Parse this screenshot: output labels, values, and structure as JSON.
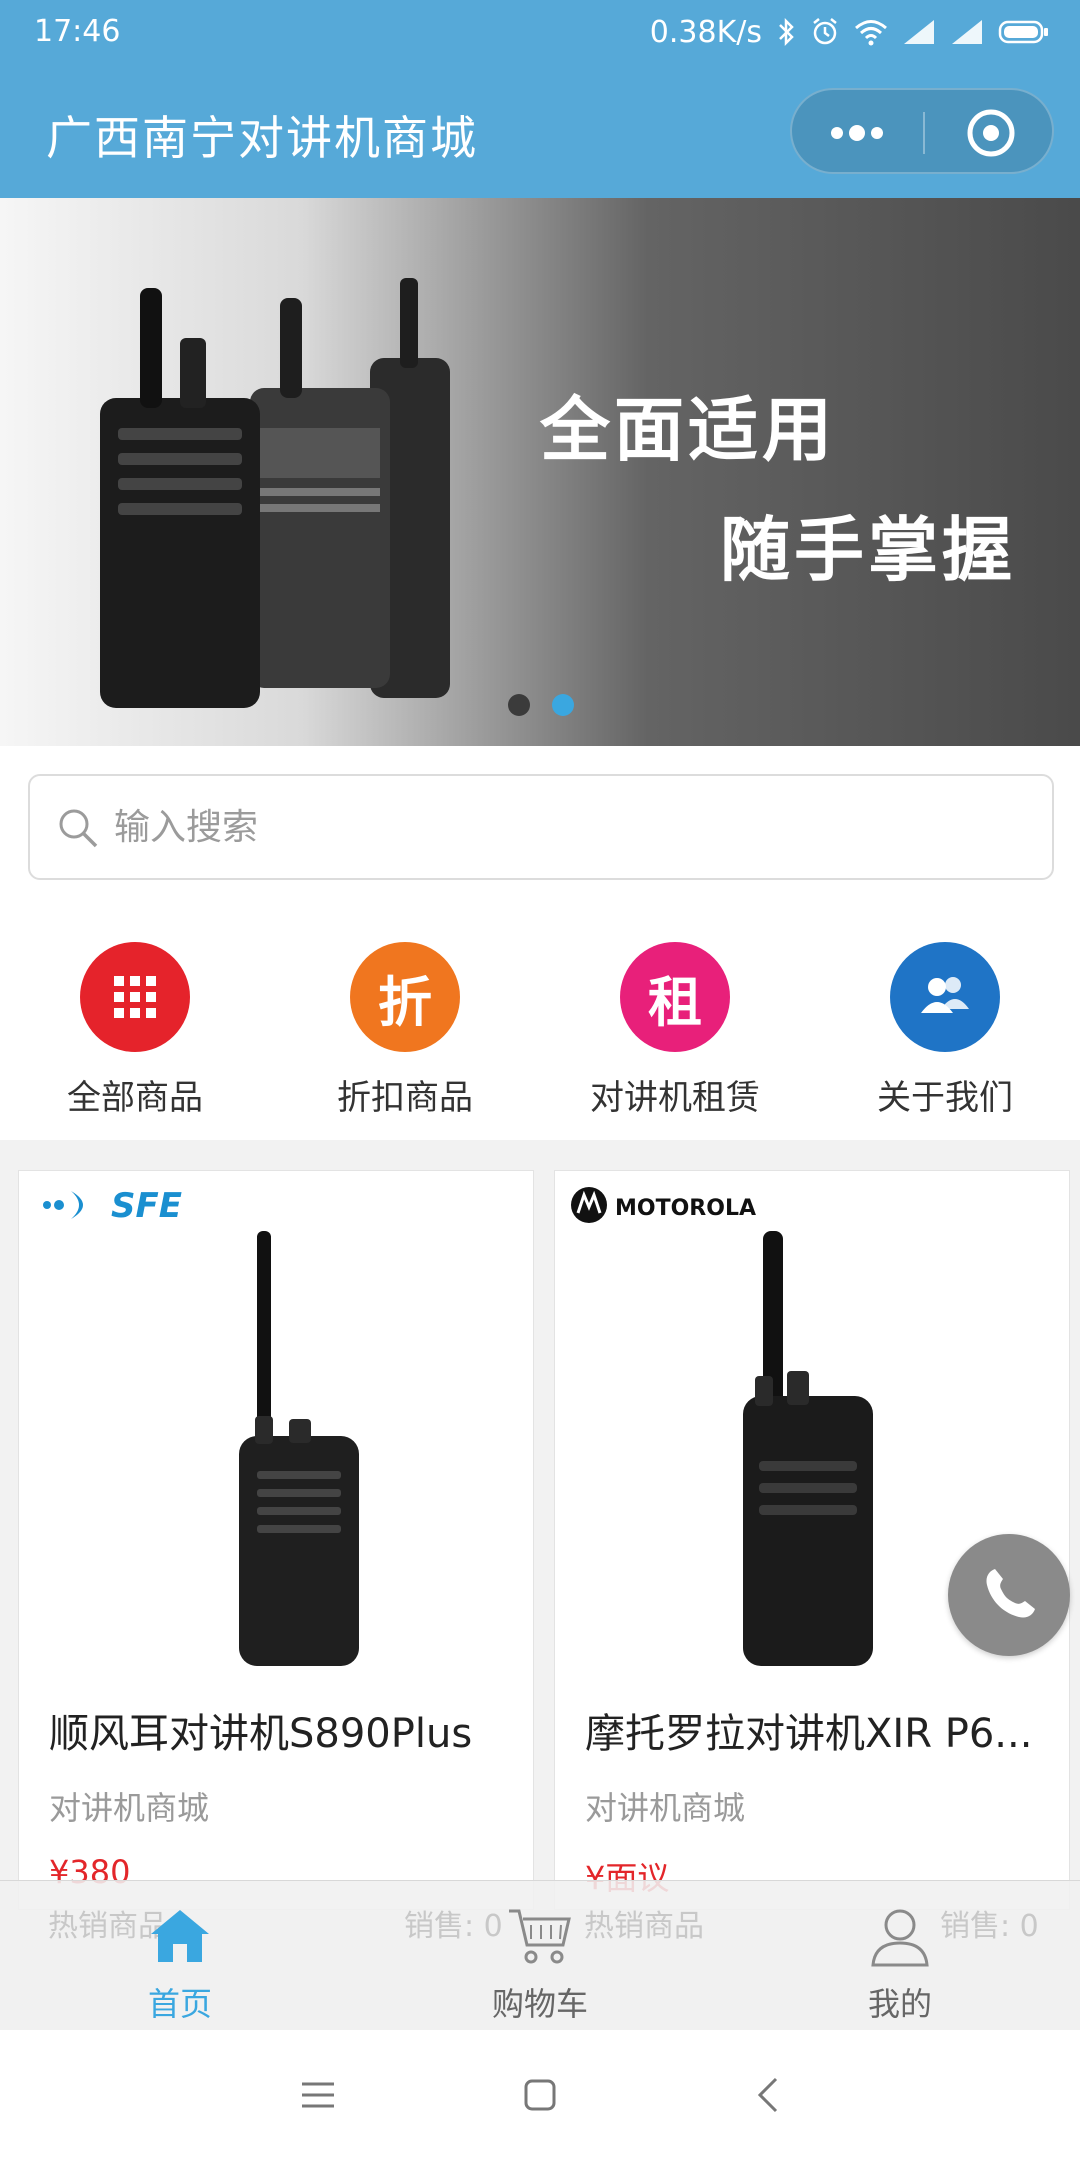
{
  "status_bar": {
    "time": "17:46",
    "net_speed": "0.38K/s",
    "icons": [
      "bluetooth-icon",
      "alarm-icon",
      "wifi-icon",
      "signal-icon",
      "signal-icon",
      "battery-icon"
    ]
  },
  "header": {
    "title": "广西南宁对讲机商城"
  },
  "banner": {
    "line1": "全面适用",
    "line2": "随手掌握",
    "slide_count": 2,
    "active_slide": 2,
    "colors": {
      "dot_active": "#3aa7e0",
      "dot_inactive": "#3b3b3b"
    }
  },
  "search": {
    "placeholder": "输入搜索",
    "value": ""
  },
  "categories": [
    {
      "label": "全部商品",
      "icon": "grid-icon",
      "color": "#e5232b"
    },
    {
      "label": "折扣商品",
      "icon": "discount-icon",
      "glyph": "折",
      "color": "#f0761f"
    },
    {
      "label": "对讲机租赁",
      "icon": "rent-icon",
      "glyph": "租",
      "color": "#e8207a"
    },
    {
      "label": "关于我们",
      "icon": "users-icon",
      "color": "#1f74c6"
    }
  ],
  "products": [
    {
      "brand": "SFE",
      "name": "顺风耳对讲机S890Plus",
      "shop": "对讲机商城",
      "price": "¥380",
      "tag": "热销商品",
      "sales": "销售: 0"
    },
    {
      "brand": "MOTOROLA",
      "name": "摩托罗拉对讲机XIR P6...",
      "shop": "对讲机商城",
      "price": "¥面议",
      "tag": "热销商品",
      "sales": "销售: 0"
    }
  ],
  "tabbar": {
    "items": [
      {
        "label": "首页",
        "icon": "home-icon",
        "active": true
      },
      {
        "label": "购物车",
        "icon": "cart-icon",
        "active": false
      },
      {
        "label": "我的",
        "icon": "user-icon",
        "active": false
      }
    ]
  },
  "colors": {
    "primary": "#56a9d8",
    "accent": "#3aa7e0",
    "price": "#e3262a"
  }
}
